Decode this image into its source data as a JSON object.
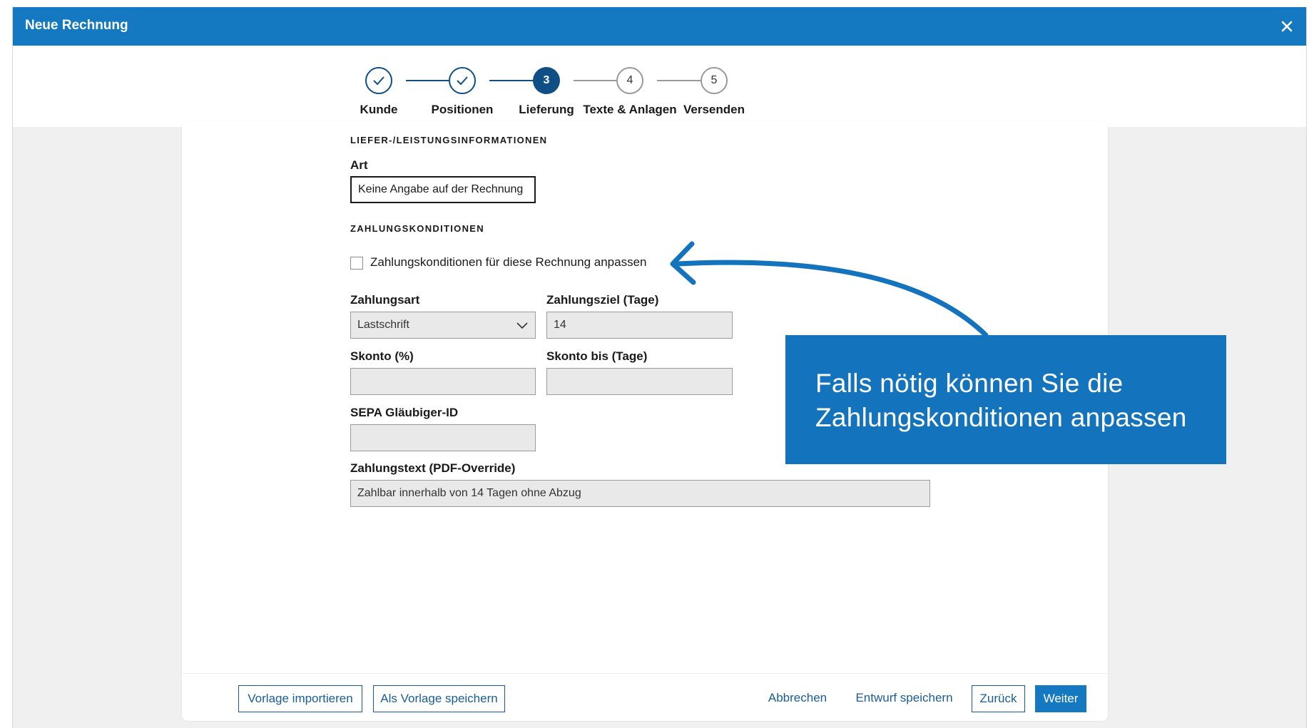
{
  "window": {
    "title": "Neue Rechnung"
  },
  "stepper": {
    "steps": [
      {
        "label": "Kunde",
        "number": "1",
        "status": "done"
      },
      {
        "label": "Positionen",
        "number": "2",
        "status": "done"
      },
      {
        "label": "Lieferung",
        "number": "3",
        "status": "active"
      },
      {
        "label": "Texte & Anlagen",
        "number": "4",
        "status": "todo"
      },
      {
        "label": "Versenden",
        "number": "5",
        "status": "todo"
      }
    ]
  },
  "delivery": {
    "heading": "LIEFER-/LEISTUNGSINFORMATIONEN",
    "art_label": "Art",
    "art_value": "Keine Angabe auf der Rechnung"
  },
  "payment": {
    "heading": "ZAHLUNGSKONDITIONEN",
    "customize_checkbox_label": "Zahlungskonditionen für diese Rechnung anpassen",
    "customize_checked": false,
    "zahlungsart_label": "Zahlungsart",
    "zahlungsart_value": "Lastschrift",
    "zahlungsziel_label": "Zahlungsziel (Tage)",
    "zahlungsziel_value": "14",
    "skonto_label": "Skonto (%)",
    "skonto_value": "",
    "skonto_bis_label": "Skonto bis (Tage)",
    "skonto_bis_value": "",
    "sepa_label": "SEPA Gläubiger-ID",
    "sepa_value": "",
    "zahlungstext_label": "Zahlungstext (PDF-Override)",
    "zahlungstext_value": "Zahlbar innerhalb von 14 Tagen ohne Abzug"
  },
  "footer": {
    "import_template": "Vorlage importieren",
    "save_as_template": "Als Vorlage speichern",
    "cancel": "Abbrechen",
    "save_draft": "Entwurf speichern",
    "back": "Zurück",
    "next": "Weiter"
  },
  "callout": {
    "line1": "Falls nötig können Sie die",
    "line2": "Zahlungskonditionen anpassen"
  },
  "colors": {
    "titlebar": "#1479c0",
    "step_active": "#0f4f86",
    "callout": "#1473bd",
    "link": "#1a5d96"
  },
  "icons": {
    "close": "close-icon",
    "check": "check-icon",
    "chevron": "chevron-down-icon",
    "arrow": "curved-arrow-annotation"
  }
}
